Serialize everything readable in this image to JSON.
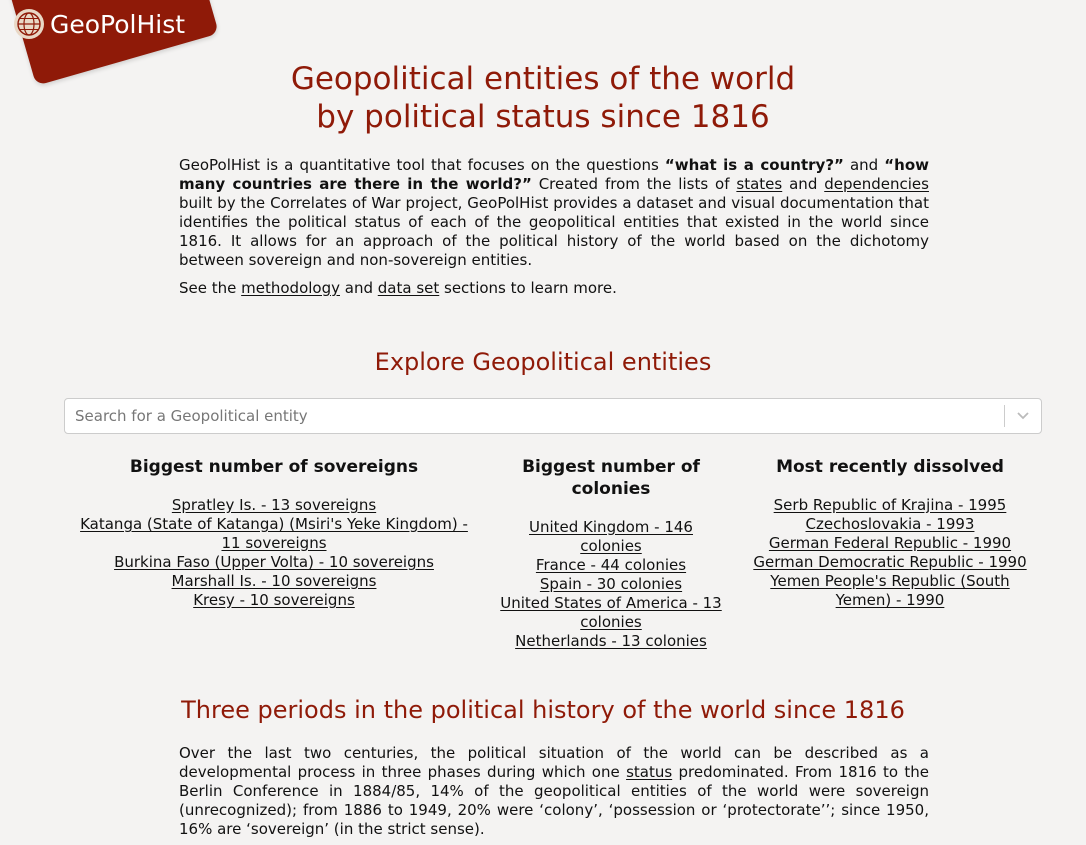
{
  "brand": {
    "name": "GeoPolHist"
  },
  "header": {
    "title_line1": "Geopolitical entities of the world",
    "title_line2": "by political status since 1816"
  },
  "intro": {
    "p1_a": "GeoPolHist is a quantitative tool that focuses on the questions ",
    "q1": "“what is a country?”",
    "p1_b": " and ",
    "q2": "“how many countries are there in the world?”",
    "p1_c": " Created from the lists of ",
    "link_states": "states",
    "p1_d": " and ",
    "link_dependencies": "dependencies",
    "p1_e": " built by the Correlates of War project, GeoPolHist provides a dataset and visual documentation that identifies the political status of each of the geopolitical entities that existed in the world since 1816. It allows for an approach of the political history of the world based on the dichotomy between sovereign and non-sovereign entities.",
    "p2_a": "See the ",
    "link_methodology": "methodology",
    "p2_b": " and ",
    "link_dataset": "data set",
    "p2_c": " sections to learn more."
  },
  "explore": {
    "heading": "Explore Geopolitical entities",
    "search_placeholder": "Search for a Geopolitical entity"
  },
  "lists": {
    "sovereigns": {
      "title": "Biggest number of sovereigns",
      "items": [
        "Spratley Is. - 13 sovereigns",
        "Katanga (State of Katanga) (Msiri's Yeke Kingdom) - 11 sovereigns",
        "Burkina Faso (Upper Volta) - 10 sovereigns",
        "Marshall Is. - 10 sovereigns",
        "Kresy - 10 sovereigns"
      ]
    },
    "colonies": {
      "title": "Biggest number of colonies",
      "items": [
        "United Kingdom - 146 colonies",
        "France - 44 colonies",
        "Spain - 30 colonies",
        "United States of America - 13 colonies",
        "Netherlands - 13 colonies"
      ]
    },
    "dissolved": {
      "title": "Most recently dissolved",
      "items": [
        "Serb Republic of Krajina - 1995",
        "Czechoslovakia - 1993",
        "German Federal Republic - 1990",
        "German Democratic Republic - 1990",
        "Yemen People's Republic (South Yemen) - 1990"
      ]
    }
  },
  "periods": {
    "heading": "Three periods in the political history of the world since 1816",
    "text_a": "Over the last two centuries, the political situation of the world can be described as a developmental process in three phases during which one ",
    "link_status": "status",
    "text_b": " predominated. From 1816 to the Berlin Conference in 1884/85, 14% of the geopolitical entities of the world were sovereign (unrecognized); from 1886 to 1949, 20% were ‘colony’, ‘possession or ‘protectorate’’; since 1950, 16% are ‘sovereign’ (in the strict sense)."
  },
  "colors": {
    "brand": "#8f1a08",
    "background": "#f4f3f2"
  },
  "icons": {
    "logo": "globe-icon",
    "dropdown": "chevron-down-icon"
  }
}
